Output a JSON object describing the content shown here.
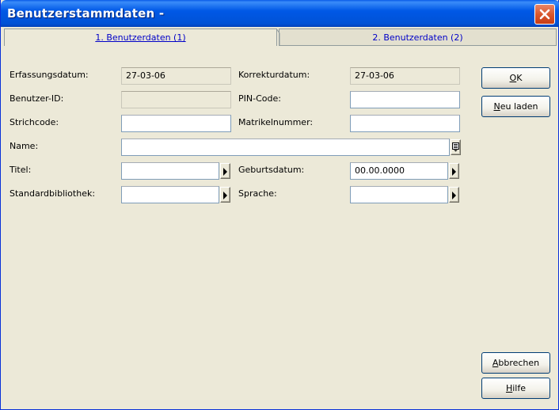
{
  "window": {
    "title": "Benutzerstammdaten -",
    "close_icon": "close-icon"
  },
  "tabs": [
    {
      "label": "1. Benutzerdaten (1)",
      "active": true
    },
    {
      "label": "2. Benutzerdaten (2)",
      "active": false
    }
  ],
  "form": {
    "erfassungsdatum": {
      "label": "Erfassungsdatum:",
      "value": "27-03-06"
    },
    "korrekturdatum": {
      "label": "Korrekturdatum:",
      "value": "27-03-06"
    },
    "benutzer_id": {
      "label": "Benutzer-ID:",
      "value": ""
    },
    "pin_code": {
      "label": "PIN-Code:",
      "value": ""
    },
    "strichcode": {
      "label": "Strichcode:",
      "value": ""
    },
    "matrikelnummer": {
      "label": "Matrikelnummer:",
      "value": ""
    },
    "name": {
      "label": "Name:",
      "value": ""
    },
    "titel": {
      "label": "Titel:",
      "value": ""
    },
    "geburtsdatum": {
      "label": "Geburtsdatum:",
      "value": "00.00.0000"
    },
    "standardbibliothek": {
      "label": "Standardbibliothek:",
      "value": ""
    },
    "sprache": {
      "label": "Sprache:",
      "value": ""
    }
  },
  "buttons": {
    "ok": {
      "first": "O",
      "rest": "K"
    },
    "neu_laden": {
      "first": "N",
      "rest": "eu laden"
    },
    "abbrechen": {
      "first": "A",
      "rest": "bbrechen"
    },
    "hilfe": {
      "first": "H",
      "rest": "ilfe"
    }
  },
  "colors": {
    "titlebar": "#0058e6",
    "dialog_bg": "#ece9d8",
    "tab_text": "#0000c8",
    "close_button": "#d9582e"
  }
}
